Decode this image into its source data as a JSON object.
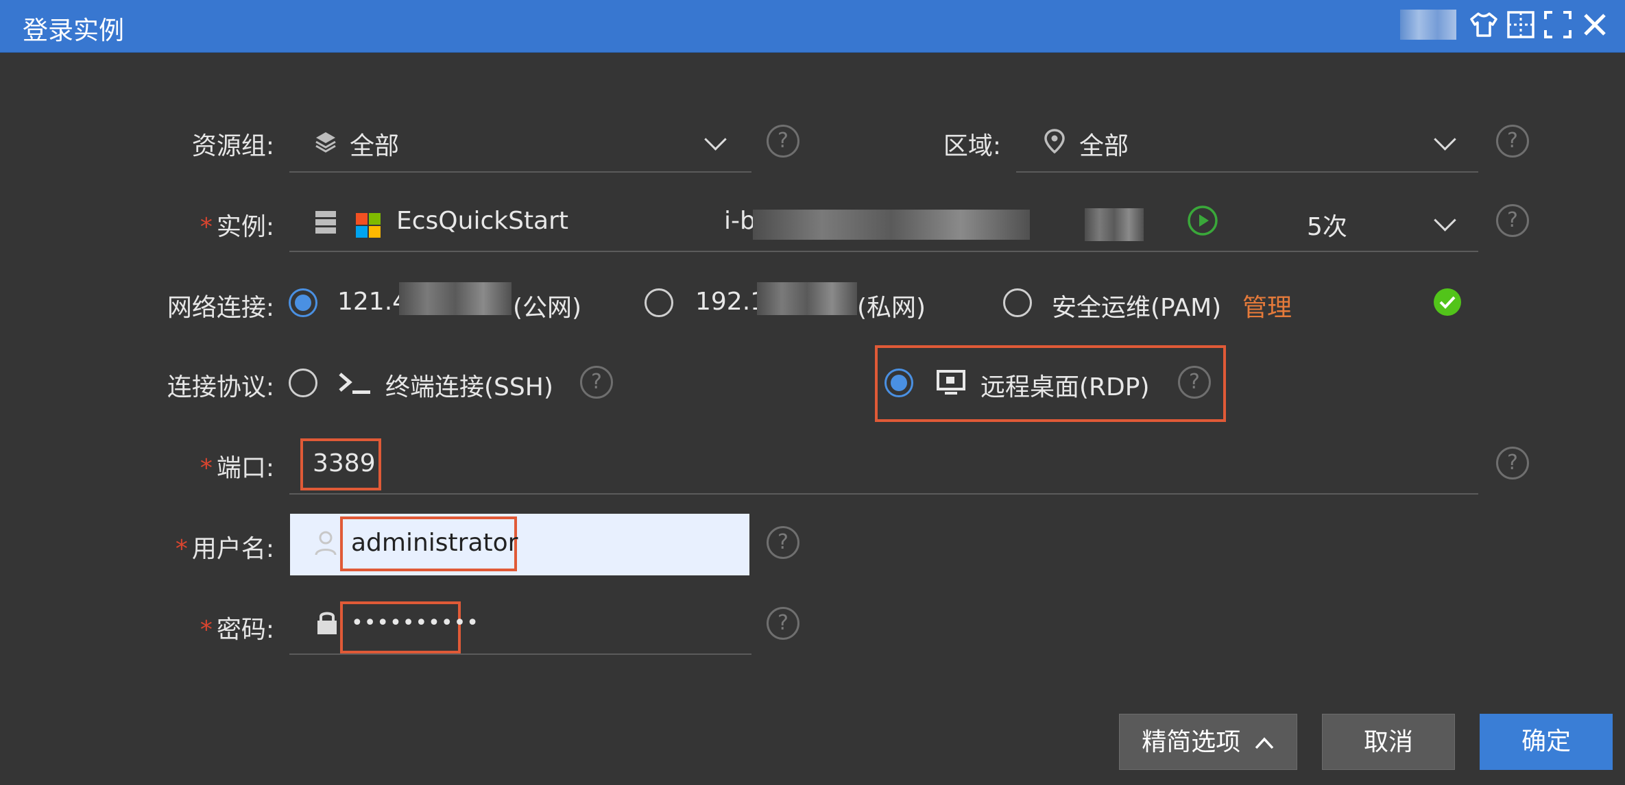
{
  "window": {
    "title": "登录实例"
  },
  "form": {
    "resource_group": {
      "label": "资源组:",
      "value": "全部"
    },
    "region": {
      "label": "区域:",
      "value": "全部"
    },
    "instance": {
      "label": "实例:",
      "name": "EcsQuickStart",
      "id_prefix": "i-b",
      "count": "5次"
    },
    "network": {
      "label": "网络连接:",
      "public_prefix": "121.4",
      "public_suffix": "(公网)",
      "private_prefix": "192.1",
      "private_suffix": "(私网)",
      "pam_label": "安全运维(PAM)",
      "pam_manage": "管理"
    },
    "protocol": {
      "label": "连接协议:",
      "ssh_label": "终端连接(SSH)",
      "rdp_label": "远程桌面(RDP)"
    },
    "port": {
      "label": "端口:",
      "value": "3389"
    },
    "username": {
      "label": "用户名:",
      "value": "administrator"
    },
    "password": {
      "label": "密码:",
      "value": "••••••••••"
    }
  },
  "buttons": {
    "simplify": "精简选项",
    "cancel": "取消",
    "confirm": "确定"
  },
  "colors": {
    "titlebar": "#3877d0",
    "background": "#353535",
    "accent": "#4a90e2",
    "required": "#d9452f",
    "manage_link": "#e57a3a",
    "highlight_box": "#e05a37",
    "success": "#52c41a"
  }
}
